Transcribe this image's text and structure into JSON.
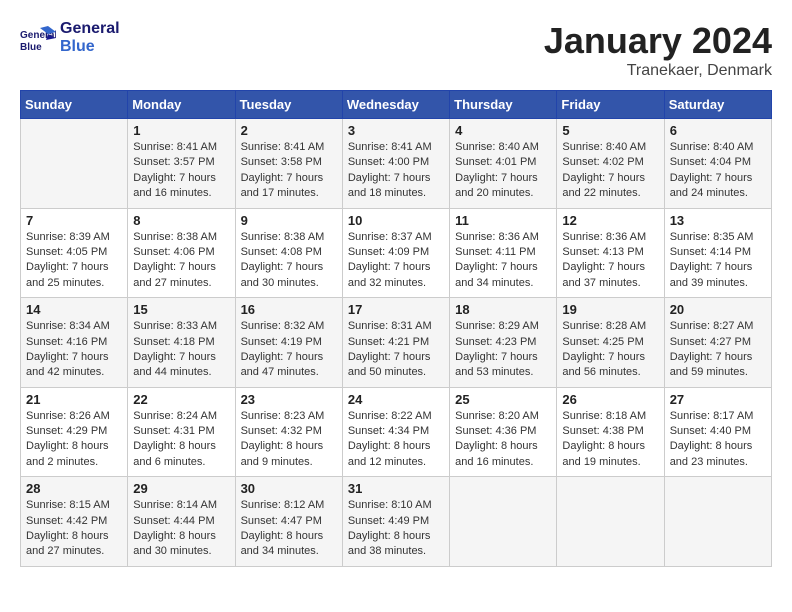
{
  "header": {
    "logo_line1": "General",
    "logo_line2": "Blue",
    "month": "January 2024",
    "location": "Tranekaer, Denmark"
  },
  "days_of_week": [
    "Sunday",
    "Monday",
    "Tuesday",
    "Wednesday",
    "Thursday",
    "Friday",
    "Saturday"
  ],
  "weeks": [
    [
      {
        "day": "",
        "content": ""
      },
      {
        "day": "1",
        "content": "Sunrise: 8:41 AM\nSunset: 3:57 PM\nDaylight: 7 hours\nand 16 minutes."
      },
      {
        "day": "2",
        "content": "Sunrise: 8:41 AM\nSunset: 3:58 PM\nDaylight: 7 hours\nand 17 minutes."
      },
      {
        "day": "3",
        "content": "Sunrise: 8:41 AM\nSunset: 4:00 PM\nDaylight: 7 hours\nand 18 minutes."
      },
      {
        "day": "4",
        "content": "Sunrise: 8:40 AM\nSunset: 4:01 PM\nDaylight: 7 hours\nand 20 minutes."
      },
      {
        "day": "5",
        "content": "Sunrise: 8:40 AM\nSunset: 4:02 PM\nDaylight: 7 hours\nand 22 minutes."
      },
      {
        "day": "6",
        "content": "Sunrise: 8:40 AM\nSunset: 4:04 PM\nDaylight: 7 hours\nand 24 minutes."
      }
    ],
    [
      {
        "day": "7",
        "content": "Sunrise: 8:39 AM\nSunset: 4:05 PM\nDaylight: 7 hours\nand 25 minutes."
      },
      {
        "day": "8",
        "content": "Sunrise: 8:38 AM\nSunset: 4:06 PM\nDaylight: 7 hours\nand 27 minutes."
      },
      {
        "day": "9",
        "content": "Sunrise: 8:38 AM\nSunset: 4:08 PM\nDaylight: 7 hours\nand 30 minutes."
      },
      {
        "day": "10",
        "content": "Sunrise: 8:37 AM\nSunset: 4:09 PM\nDaylight: 7 hours\nand 32 minutes."
      },
      {
        "day": "11",
        "content": "Sunrise: 8:36 AM\nSunset: 4:11 PM\nDaylight: 7 hours\nand 34 minutes."
      },
      {
        "day": "12",
        "content": "Sunrise: 8:36 AM\nSunset: 4:13 PM\nDaylight: 7 hours\nand 37 minutes."
      },
      {
        "day": "13",
        "content": "Sunrise: 8:35 AM\nSunset: 4:14 PM\nDaylight: 7 hours\nand 39 minutes."
      }
    ],
    [
      {
        "day": "14",
        "content": "Sunrise: 8:34 AM\nSunset: 4:16 PM\nDaylight: 7 hours\nand 42 minutes."
      },
      {
        "day": "15",
        "content": "Sunrise: 8:33 AM\nSunset: 4:18 PM\nDaylight: 7 hours\nand 44 minutes."
      },
      {
        "day": "16",
        "content": "Sunrise: 8:32 AM\nSunset: 4:19 PM\nDaylight: 7 hours\nand 47 minutes."
      },
      {
        "day": "17",
        "content": "Sunrise: 8:31 AM\nSunset: 4:21 PM\nDaylight: 7 hours\nand 50 minutes."
      },
      {
        "day": "18",
        "content": "Sunrise: 8:29 AM\nSunset: 4:23 PM\nDaylight: 7 hours\nand 53 minutes."
      },
      {
        "day": "19",
        "content": "Sunrise: 8:28 AM\nSunset: 4:25 PM\nDaylight: 7 hours\nand 56 minutes."
      },
      {
        "day": "20",
        "content": "Sunrise: 8:27 AM\nSunset: 4:27 PM\nDaylight: 7 hours\nand 59 minutes."
      }
    ],
    [
      {
        "day": "21",
        "content": "Sunrise: 8:26 AM\nSunset: 4:29 PM\nDaylight: 8 hours\nand 2 minutes."
      },
      {
        "day": "22",
        "content": "Sunrise: 8:24 AM\nSunset: 4:31 PM\nDaylight: 8 hours\nand 6 minutes."
      },
      {
        "day": "23",
        "content": "Sunrise: 8:23 AM\nSunset: 4:32 PM\nDaylight: 8 hours\nand 9 minutes."
      },
      {
        "day": "24",
        "content": "Sunrise: 8:22 AM\nSunset: 4:34 PM\nDaylight: 8 hours\nand 12 minutes."
      },
      {
        "day": "25",
        "content": "Sunrise: 8:20 AM\nSunset: 4:36 PM\nDaylight: 8 hours\nand 16 minutes."
      },
      {
        "day": "26",
        "content": "Sunrise: 8:18 AM\nSunset: 4:38 PM\nDaylight: 8 hours\nand 19 minutes."
      },
      {
        "day": "27",
        "content": "Sunrise: 8:17 AM\nSunset: 4:40 PM\nDaylight: 8 hours\nand 23 minutes."
      }
    ],
    [
      {
        "day": "28",
        "content": "Sunrise: 8:15 AM\nSunset: 4:42 PM\nDaylight: 8 hours\nand 27 minutes."
      },
      {
        "day": "29",
        "content": "Sunrise: 8:14 AM\nSunset: 4:44 PM\nDaylight: 8 hours\nand 30 minutes."
      },
      {
        "day": "30",
        "content": "Sunrise: 8:12 AM\nSunset: 4:47 PM\nDaylight: 8 hours\nand 34 minutes."
      },
      {
        "day": "31",
        "content": "Sunrise: 8:10 AM\nSunset: 4:49 PM\nDaylight: 8 hours\nand 38 minutes."
      },
      {
        "day": "",
        "content": ""
      },
      {
        "day": "",
        "content": ""
      },
      {
        "day": "",
        "content": ""
      }
    ]
  ]
}
